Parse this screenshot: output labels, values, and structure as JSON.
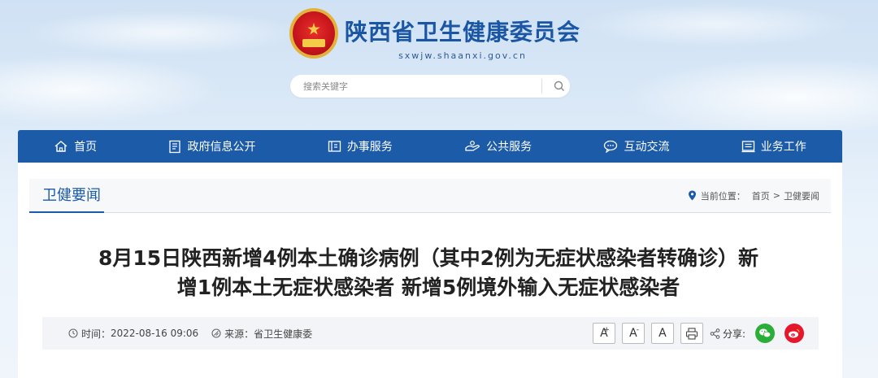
{
  "header": {
    "site_title": "陕西省卫生健康委员会",
    "site_domain": "sxwjw.shaanxi.gov.cn"
  },
  "search": {
    "placeholder": "搜索关键字"
  },
  "nav": {
    "items": [
      {
        "label": "首页",
        "icon": "home-icon"
      },
      {
        "label": "政府信息公开",
        "icon": "document-icon"
      },
      {
        "label": "办事服务",
        "icon": "folder-icon"
      },
      {
        "label": "公共服务",
        "icon": "service-icon"
      },
      {
        "label": "互动交流",
        "icon": "chat-icon"
      },
      {
        "label": "业务工作",
        "icon": "briefcase-icon"
      }
    ]
  },
  "section": {
    "title": "卫健要闻",
    "location_label": "当前位置：",
    "breadcrumb": [
      "首页",
      "卫健要闻"
    ],
    "breadcrumb_sep": ">"
  },
  "article": {
    "title_line1": "8月15日陕西新增4例本土确诊病例（其中2例为无症状感染者转确诊）新",
    "title_line2": "增1例本土无症状感染者 新增5例境外输入无症状感染者",
    "time_label": "时间：",
    "time_value": "2022-08-16 09:06",
    "source_label": "来源：",
    "source_value": "省卫生健康委",
    "font_large": "A",
    "font_large_sup": "+",
    "font_small": "A",
    "font_small_sup": "-",
    "font_default": "A",
    "share_label": "分享:"
  },
  "colors": {
    "nav_bg": "#1c5ba8",
    "accent": "#1c5ba8",
    "wechat": "#2aae37",
    "weibo": "#e6162d"
  }
}
